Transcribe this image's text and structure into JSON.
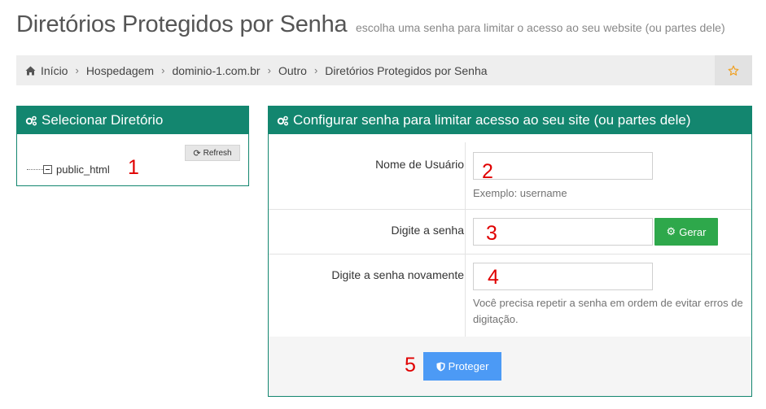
{
  "header": {
    "title": "Diretórios Protegidos por Senha",
    "subtitle": "escolha uma senha para limitar o acesso ao seu website (ou partes dele)"
  },
  "breadcrumb": [
    "Início",
    "Hospedagem",
    "dominio-1.com.br",
    "Outro",
    "Diretórios Protegidos por Senha"
  ],
  "left_panel": {
    "title": "Selecionar Diretório",
    "refresh_label": "Refresh",
    "tree_item": "public_html"
  },
  "right_panel": {
    "title": "Configurar senha para limitar acesso ao seu site (ou partes dele)",
    "username": {
      "label": "Nome de Usuário",
      "value": "",
      "help": "Exemplo: username"
    },
    "password": {
      "label": "Digite a senha",
      "value": "",
      "generate_label": "Gerar"
    },
    "password_repeat": {
      "label": "Digite a senha novamente",
      "value": "",
      "help": "Você precisa repetir a senha em ordem de evitar erros de digitação."
    },
    "submit_label": "Proteger"
  },
  "annotations": [
    "1",
    "2",
    "3",
    "4",
    "5"
  ],
  "colors": {
    "panel_header": "#13866f",
    "generate_button": "#2ea84b",
    "protect_button": "#4c9af5",
    "annotation": "#e00000",
    "star": "#f0a020"
  }
}
